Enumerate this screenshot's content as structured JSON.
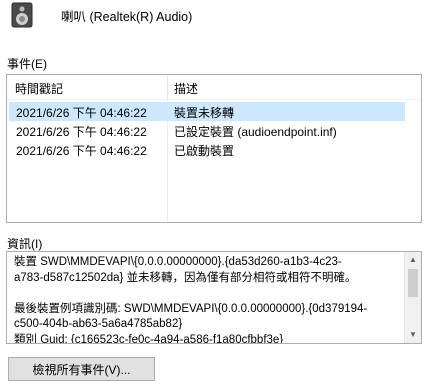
{
  "device": {
    "title": "喇叭 (Realtek(R) Audio)",
    "icon": "speaker-icon"
  },
  "events": {
    "label": "事件(E)",
    "columns": [
      "時間戳記",
      "描述"
    ],
    "rows": [
      {
        "time": "2021/6/26 下午 04:46:22",
        "desc": "裝置未移轉",
        "selected": true
      },
      {
        "time": "2021/6/26 下午 04:46:22",
        "desc": "已設定裝置 (audioendpoint.inf)",
        "selected": false
      },
      {
        "time": "2021/6/26 下午 04:46:22",
        "desc": "已啟動裝置",
        "selected": false
      }
    ]
  },
  "info": {
    "label": "資訊(I)",
    "text": "裝置 SWD\\MMDEVAPI\\{0.0.0.00000000}.{da53d260-a1b3-4c23-\na783-d587c12502da} 並未移轉，因為僅有部分相符或相符不明確。\n\n最後裝置例項識別碼: SWD\\MMDEVAPI\\{0.0.0.00000000}.{0d379194-\nc500-404b-ab63-5a6a4785ab82}\n類別 Guid: {c166523c-fe0c-4a94-a586-f1a80cfbbf3e}"
  },
  "buttons": {
    "view_all": "檢視所有事件(V)..."
  },
  "colors": {
    "selection": "#cce8ff",
    "button_bg": "#e1e1e1",
    "border": "#adadad"
  }
}
